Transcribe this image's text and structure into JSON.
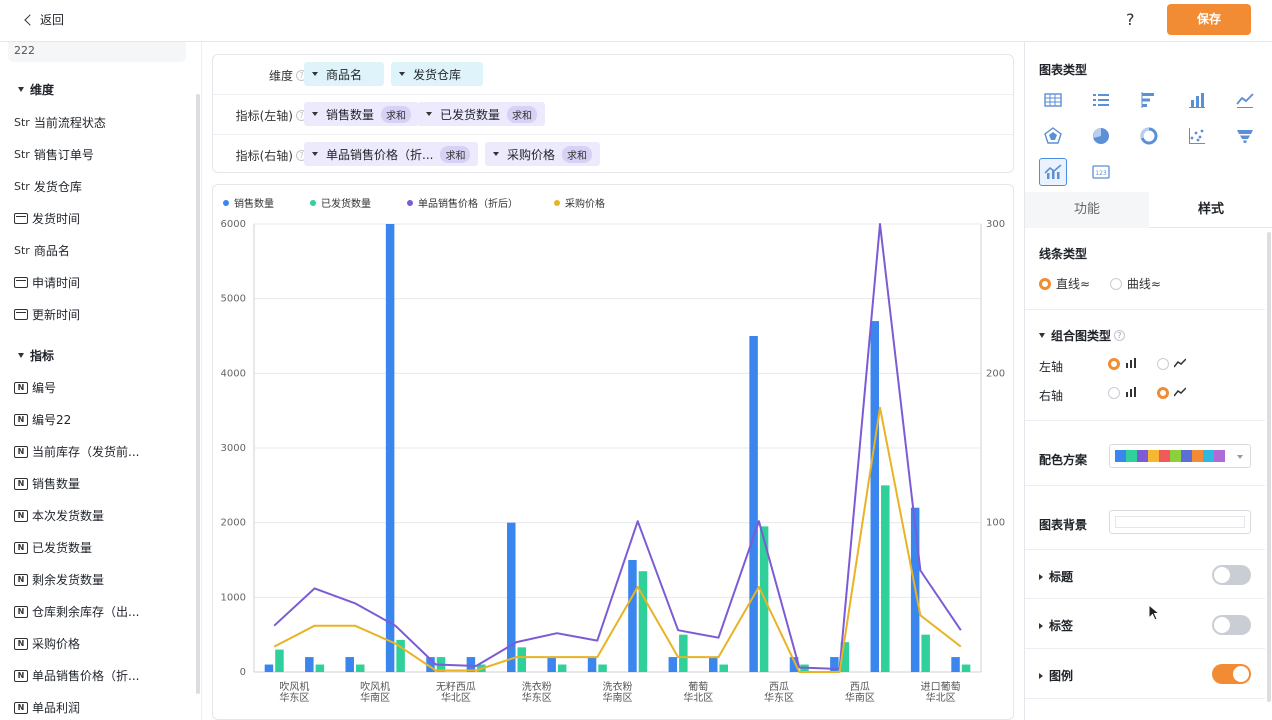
{
  "header": {
    "back_label": "返回",
    "help_label": "?",
    "save_label": "保存"
  },
  "left": {
    "top_item": "222",
    "dimension_title": "维度",
    "dimensions": [
      {
        "type": "Str",
        "label": "当前流程状态"
      },
      {
        "type": "Str",
        "label": "销售订单号"
      },
      {
        "type": "Str",
        "label": "发货仓库"
      },
      {
        "type": "date",
        "label": "发货时间"
      },
      {
        "type": "Str",
        "label": "商品名"
      },
      {
        "type": "date",
        "label": "申请时间"
      },
      {
        "type": "date",
        "label": "更新时间"
      }
    ],
    "metric_title": "指标",
    "metrics": [
      {
        "type": "N",
        "label": "编号"
      },
      {
        "type": "N",
        "label": "编号22"
      },
      {
        "type": "N",
        "label": "当前库存（发货前..."
      },
      {
        "type": "N",
        "label": "销售数量"
      },
      {
        "type": "N",
        "label": "本次发货数量"
      },
      {
        "type": "N",
        "label": "已发货数量"
      },
      {
        "type": "N",
        "label": "剩余发货数量"
      },
      {
        "type": "N",
        "label": "仓库剩余库存（出..."
      },
      {
        "type": "N",
        "label": "采购价格"
      },
      {
        "type": "N",
        "label": "单品销售价格（折..."
      },
      {
        "type": "N",
        "label": "单品利润"
      }
    ]
  },
  "config": {
    "dimension_label": "维度",
    "dimension_pills": [
      "商品名",
      "发货仓库"
    ],
    "left_axis_label": "指标(左轴)",
    "left_axis_pills": [
      {
        "name": "销售数量",
        "agg": "求和"
      },
      {
        "name": "已发货数量",
        "agg": "求和"
      }
    ],
    "right_axis_label": "指标(右轴)",
    "right_axis_pills": [
      {
        "name": "单品销售价格（折...",
        "agg": "求和"
      },
      {
        "name": "采购价格",
        "agg": "求和"
      }
    ]
  },
  "chart_data": {
    "type": "bar",
    "legend_position": "top-left",
    "grid": true,
    "categories": [
      "吹风机\n华东区",
      "吹风机\n华南区",
      "无籽西瓜\n华北区",
      "洗衣粉\n华东区",
      "洗衣粉\n华南区",
      "葡萄\n华北区",
      "西瓜\n华东区",
      "西瓜\n华南区",
      "进口葡萄\n华北区"
    ],
    "x_slots": 18,
    "label_slots": [
      0,
      2,
      4,
      6,
      8,
      10,
      12,
      14,
      16
    ],
    "ylim_left": [
      0,
      6000
    ],
    "yticks_left": [
      "0",
      "1000",
      "2000",
      "3000",
      "4000",
      "5000",
      "6000"
    ],
    "ylim_right": [
      0,
      300
    ],
    "yticks_right": [
      "100",
      "200",
      "300"
    ],
    "series": [
      {
        "name": "销售数量",
        "axis": "left",
        "kind": "bar",
        "color": "#3a86ee",
        "values": [
          100,
          200,
          200,
          6000,
          200,
          200,
          2000,
          200,
          200,
          1500,
          200,
          200,
          4500,
          200,
          200,
          4700,
          2200,
          200
        ]
      },
      {
        "name": "已发货数量",
        "axis": "left",
        "kind": "bar",
        "color": "#2fd09a",
        "values": [
          300,
          100,
          100,
          430,
          200,
          100,
          330,
          100,
          100,
          1350,
          500,
          100,
          1950,
          100,
          400,
          2500,
          500,
          100
        ]
      },
      {
        "name": "单品销售价格（折后）",
        "axis": "right",
        "kind": "line",
        "color": "#7b5bd6",
        "values": [
          31,
          56,
          46,
          31,
          5,
          4,
          20,
          26,
          21,
          101,
          28,
          23,
          101,
          3,
          2,
          300,
          68,
          28
        ]
      },
      {
        "name": "采购价格",
        "axis": "right",
        "kind": "line",
        "color": "#e8b325",
        "values": [
          17,
          31,
          31,
          19,
          1,
          1,
          10,
          10,
          10,
          57,
          10,
          10,
          57,
          0,
          0,
          177,
          38,
          17
        ]
      }
    ]
  },
  "right": {
    "chart_type_title": "图表类型",
    "chart_types": [
      "table-icon",
      "list-icon",
      "horizontal-bar-icon",
      "bar-chart-icon",
      "line-chart-icon",
      "radar-icon",
      "pie-icon",
      "donut-icon",
      "scatter-icon",
      "funnel-icon",
      "combo-chart-icon",
      "number-card-icon"
    ],
    "selected_type": "combo-chart-icon",
    "tab_function": "功能",
    "tab_style": "样式",
    "line_type_title": "线条类型",
    "line_straight": "直线≈",
    "line_curve": "曲线≈",
    "combo_title": "组合图类型",
    "left_axis": "左轴",
    "right_axis": "右轴",
    "palette_title": "配色方案",
    "palette": [
      "#3a86ee",
      "#2fd09a",
      "#7b5bd6",
      "#f5b82e",
      "#ef5a5a",
      "#8ecf3e",
      "#5c6fd6",
      "#f28c34",
      "#2fb8e0",
      "#b06ad6"
    ],
    "bg_title": "图表背景",
    "title_section": "标题",
    "label_section": "标签",
    "legend_section": "图例",
    "toggles": {
      "title": false,
      "label": false,
      "legend": true
    }
  }
}
